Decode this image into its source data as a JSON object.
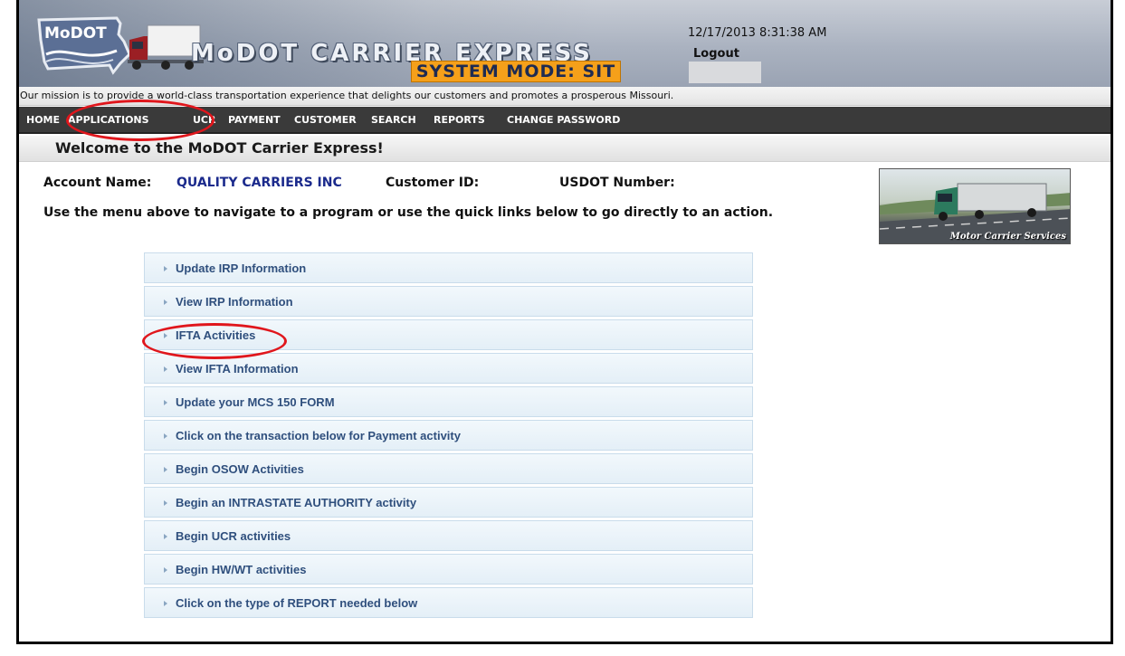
{
  "header": {
    "logo_text": "MoDOT",
    "title": "MoDOT CARRIER EXPRESS",
    "system_mode": "SYSTEM MODE: SIT",
    "timestamp": "12/17/2013 8:31:38 AM",
    "logout_label": "Logout"
  },
  "mission": "Our mission is to provide a world-class transportation experience that delights our customers and promotes a prosperous Missouri.",
  "nav": {
    "items": [
      {
        "label": "HOME"
      },
      {
        "label": "APPLICATIONS"
      },
      {
        "label": "UCR"
      },
      {
        "label": "PAYMENT"
      },
      {
        "label": "CUSTOMER"
      },
      {
        "label": "SEARCH"
      },
      {
        "label": "REPORTS"
      },
      {
        "label": "CHANGE PASSWORD"
      }
    ]
  },
  "welcome": "Welcome to the MoDOT Carrier Express!",
  "account": {
    "name_label": "Account Name:",
    "name_value": "QUALITY CARRIERS INC",
    "customer_id_label": "Customer ID:",
    "customer_id_value": "",
    "usdot_label": "USDOT Number:",
    "usdot_value": ""
  },
  "instructions": "Use the menu above to navigate to a program or use the quick links below to go directly to an action.",
  "image_caption": "Motor Carrier Services",
  "quick_links": [
    {
      "label": "Update IRP Information"
    },
    {
      "label": "View IRP Information"
    },
    {
      "label": "IFTA Activities"
    },
    {
      "label": "View IFTA Information"
    },
    {
      "label": "Update your MCS 150 FORM"
    },
    {
      "label": "Click on the transaction below for Payment activity"
    },
    {
      "label": "Begin OSOW Activities"
    },
    {
      "label": "Begin an INTRASTATE AUTHORITY activity"
    },
    {
      "label": "Begin UCR activities"
    },
    {
      "label": "Begin HW/WT activities"
    },
    {
      "label": "Click on the type of REPORT needed below"
    }
  ],
  "annotations": {
    "highlighted": [
      "APPLICATIONS",
      "IFTA Activities"
    ],
    "highlight_color": "#e0161c"
  },
  "colors": {
    "nav_bg": "#3a3a3a",
    "system_mode_bg": "#f5a01a",
    "account_value": "#1b2a8c",
    "quick_link_text": "#2f4f7d"
  }
}
